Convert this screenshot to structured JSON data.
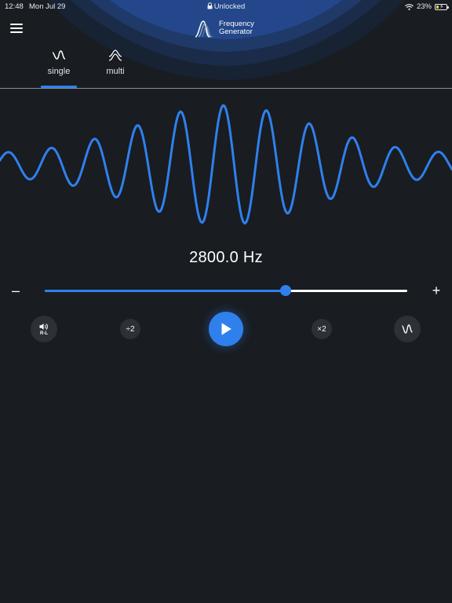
{
  "status_bar": {
    "time": "12:48",
    "date": "Mon Jul 29",
    "lock_status": "Unlocked",
    "battery": "23%",
    "battery_level": 0.23
  },
  "header": {
    "logo_line1": "Frequency",
    "logo_line2": "Generator",
    "menu_icon": "hamburger-menu-icon"
  },
  "tabs": [
    {
      "label": "single",
      "icon": "sine-wave-icon",
      "active": true
    },
    {
      "label": "multi",
      "icon": "stacked-waves-icon",
      "active": false
    }
  ],
  "frequency": {
    "display": "2800.0 Hz",
    "slider_position": 0.665
  },
  "controls": {
    "stereo_sub_label": "R-L",
    "halve_label": "÷2",
    "double_label": "×2",
    "play_icon": "play-icon",
    "waveform_icon": "waveform-type-icon"
  },
  "colors": {
    "background": "#191c21",
    "accent": "#2f80ed",
    "button_bg": "#2c3037",
    "text": "#ffffff"
  }
}
